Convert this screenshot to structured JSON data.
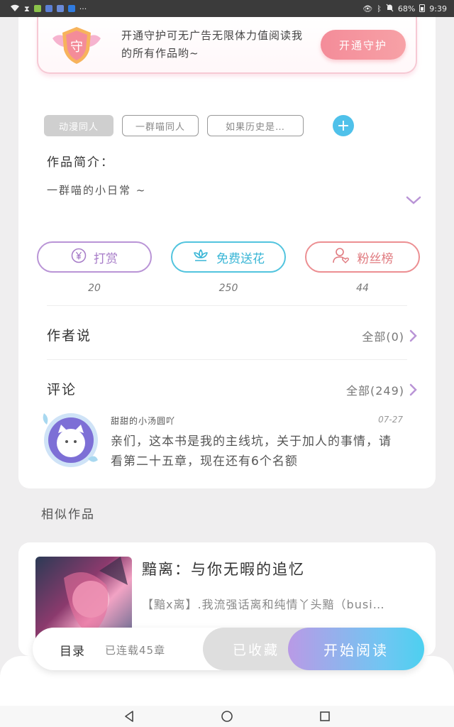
{
  "statusbar": {
    "battery": "68%",
    "time": "9:39",
    "more": "···"
  },
  "guard": {
    "badge_char": "守",
    "text": "开通守护可无广告无限体力值阅读我的所有作品哟~",
    "button": "开通守护"
  },
  "tags": [
    "动漫同人",
    "一群喵同人",
    "如果历史是…"
  ],
  "tag_add": "+",
  "intro": {
    "title": "作品简介：",
    "text": "一群喵的小日常 ~"
  },
  "actions": [
    {
      "label": "打赏",
      "count": "20",
      "icon": "yen-coin-icon",
      "color": "#a77cc8"
    },
    {
      "label": "免费送花",
      "count": "250",
      "icon": "flower-icon",
      "color": "#3ab6d6"
    },
    {
      "label": "粉丝榜",
      "count": "44",
      "icon": "fan-user-icon",
      "color": "#e07a7f"
    }
  ],
  "author_say": {
    "title": "作者说",
    "more": "全部(0)"
  },
  "comments": {
    "title": "评论",
    "more": "全部(249)",
    "latest": {
      "user": "甜甜的小汤圆吖",
      "date": "07-27",
      "text": "亲们，这本书是我的主线坑，关于加人的事情，请看第二十五章，现在还有6个名额"
    }
  },
  "similar": {
    "title": "相似作品",
    "book": {
      "title": "黯离：与你无暇的追忆",
      "desc": "【黯x离】.我流强话离和纯情丫头黯（busi…"
    }
  },
  "bottom": {
    "toc": "目录",
    "count": "已连载45章",
    "collected": "已收藏",
    "read": "开始阅读"
  }
}
